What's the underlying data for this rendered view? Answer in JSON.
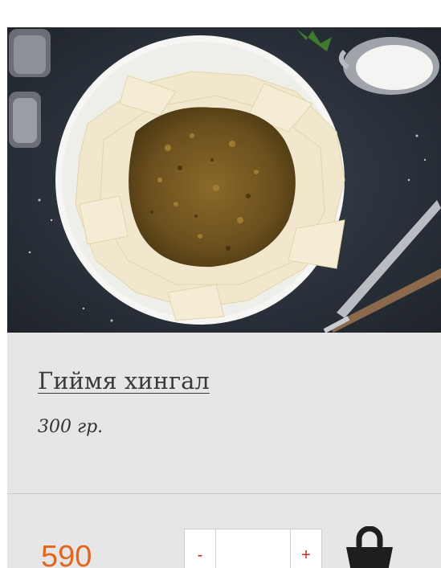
{
  "product": {
    "image": "khingal-dish-photo",
    "name": "Гиймя хингал",
    "weight": "300 гр.",
    "price": "590",
    "quantity": "",
    "decrement_label": "-",
    "increment_label": "+",
    "cart_icon": "shopping-bag-icon"
  },
  "colors": {
    "price": "#e2661c",
    "stepper": "#c02a1f",
    "card_bg": "#e6e6e6"
  }
}
